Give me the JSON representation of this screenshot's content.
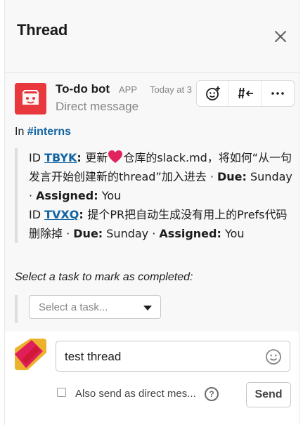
{
  "header": {
    "title": "Thread"
  },
  "message": {
    "sender": "To-do bot",
    "app_badge": "APP",
    "timestamp": "Today at 3",
    "subtitle": "Direct message",
    "in_prefix": "In ",
    "channel": "#interns",
    "tasks": [
      {
        "id_prefix": "ID ",
        "id": "TBYK",
        "sep": ": ",
        "text_before_heart": "更新",
        "text_after_heart": "仓库的slack.md，将如何“从一句发言开始创建新的thread”加入进去 · ",
        "due_label": "Due:",
        "due_value": " Sunday · ",
        "assigned_label": "Assigned:",
        "assigned_value": " You"
      },
      {
        "id_prefix": "ID ",
        "id": "TVXQ",
        "sep": ": ",
        "text": "提个PR把自动生成没有用上的Prefs代码删除掉 · ",
        "due_label": "Due:",
        "due_value": " Sunday · ",
        "assigned_label": "Assigned:",
        "assigned_value": " You"
      }
    ],
    "instruction": "Select a task to mark as completed:",
    "select_placeholder": "Select a task..."
  },
  "composer": {
    "input_value": "test thread",
    "also_send_label": "Also send as direct mes...",
    "help_glyph": "?",
    "send_label": "Send"
  },
  "colors": {
    "accent_link": "#1264a3",
    "bot_avatar": "#e8383d",
    "heart": "#e0245e",
    "user_avatar_red": "#e01e5a",
    "user_avatar_yellow": "#ecb22e"
  },
  "icons": [
    "close-icon",
    "add-reaction-icon",
    "share-thread-icon",
    "more-icon",
    "heart-icon",
    "chevron-down-icon",
    "emoji-icon",
    "help-icon"
  ]
}
